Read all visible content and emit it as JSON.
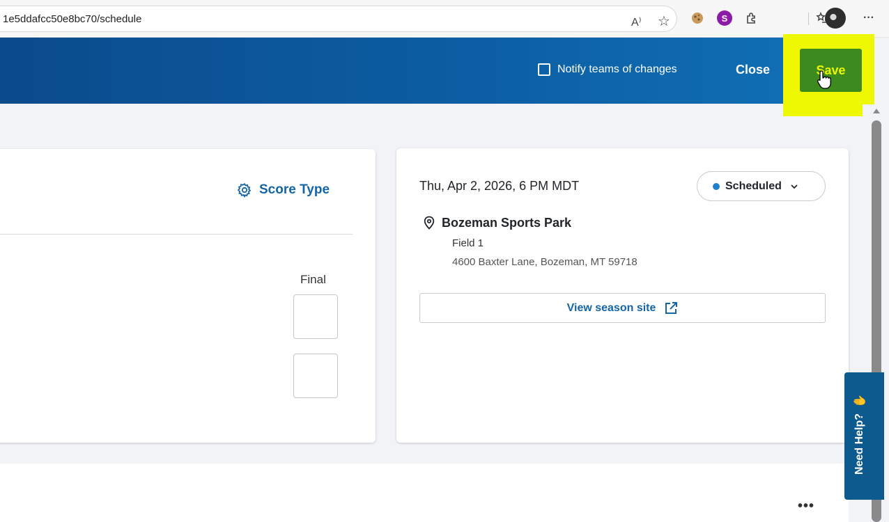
{
  "browser": {
    "url": "1e5ddafcc50e8bc70/schedule",
    "read_aloud": "A⁾",
    "star": "☆",
    "s_extension": "S",
    "more_menu": "···"
  },
  "header": {
    "notify_label": "Notify teams of changes",
    "close_label": "Close",
    "save_label": "Save"
  },
  "score_panel": {
    "score_type_label": "Score Type",
    "final_label": "Final"
  },
  "event": {
    "datetime": "Thu, Apr 2, 2026, 6 PM MDT",
    "status": "Scheduled",
    "venue": "Bozeman Sports Park",
    "field": "Field 1",
    "address": "4600 Baxter Lane, Bozeman, MT 59718",
    "season_site_label": "View season site"
  },
  "footer": {
    "more_label": "•••"
  },
  "help": {
    "label": "Need Help?",
    "hand": "✋"
  },
  "colors": {
    "header_start": "#0b4b8c",
    "header_end": "#1272b8",
    "save_bg": "#3d8a1e",
    "highlight": "#eef800",
    "link_blue": "#1565a6",
    "status_dot": "#1e7fd1"
  },
  "icons": [
    "read-aloud-icon",
    "favorite-star-icon",
    "extension-icon",
    "profile-icon",
    "gear-icon",
    "location-pin-icon",
    "chevron-down-icon",
    "external-link-icon",
    "pointer-cursor-icon",
    "hand-icon"
  ]
}
